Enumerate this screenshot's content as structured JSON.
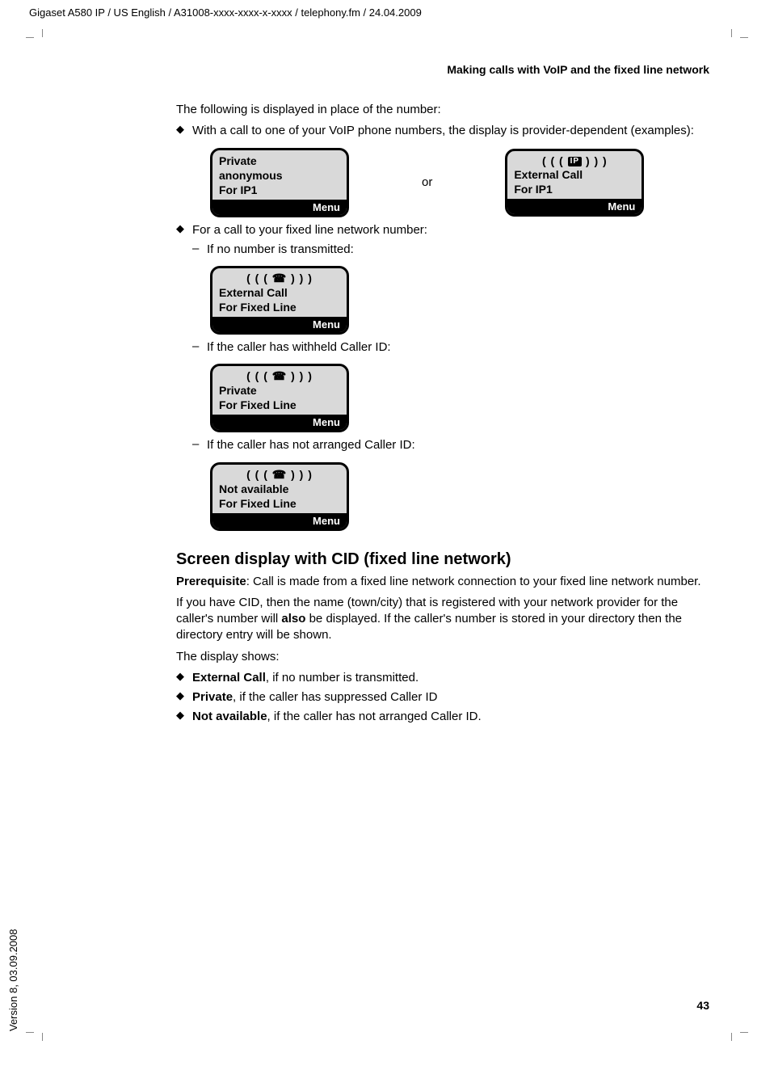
{
  "header": "Gigaset A580 IP / US English / A31008-xxxx-xxxx-x-xxxx / telephony.fm / 24.04.2009",
  "running_head": "Making calls with VoIP and the fixed line network",
  "intro": "The following is displayed in place of the number:",
  "bullets": {
    "b1": "With a call to one of your VoIP phone numbers, the display is provider-dependent (examples):",
    "b2": "For a call to your fixed line network number:"
  },
  "or_word": "or",
  "dashes": {
    "d1": "If no number is transmitted:",
    "d2": "If the caller has withheld Caller ID:",
    "d3": "If the caller has not arranged Caller ID:"
  },
  "screens": {
    "s1": {
      "line1": "Private",
      "line2": "anonymous",
      "line3": "For IP1",
      "menu": "Menu"
    },
    "s2": {
      "ring_l": "( ( (",
      "ring_badge": "IP",
      "ring_r": ") ) )",
      "line1": "External Call",
      "line2": "For IP1",
      "menu": "Menu"
    },
    "s3": {
      "ring_l": "( ( (",
      "ring_sym": "☎",
      "ring_r": ") ) )",
      "line1": "External Call",
      "line2": "For Fixed Line",
      "menu": "Menu"
    },
    "s4": {
      "ring_l": "( ( (",
      "ring_sym": "☎",
      "ring_r": ") ) )",
      "line1": "Private",
      "line2": "For Fixed Line",
      "menu": "Menu"
    },
    "s5": {
      "ring_l": "( ( (",
      "ring_sym": "☎",
      "ring_r": ") ) )",
      "line1": "Not available",
      "line2": "For Fixed Line",
      "menu": "Menu"
    }
  },
  "section_title": "Screen display with CID (fixed line network)",
  "prereq_label": "Prerequisite",
  "prereq_text": ": Call is made from a fixed line network connection to your fixed line network number.",
  "cid_p1_a": "If you have CID, then the name (town/city) that is registered with your network provider for the caller's number will ",
  "cid_p1_bold": "also",
  "cid_p1_b": " be displayed. If the caller's number is stored in your directory then the directory entry will be shown.",
  "shows_intro": "The display shows:",
  "shows": {
    "i1_bold": "External Call",
    "i1_rest": ", if no number is transmitted.",
    "i2_bold": "Private",
    "i2_rest": ", if the caller has suppressed Caller ID",
    "i3_bold": "Not available",
    "i3_rest": ", if the caller has not arranged Caller ID."
  },
  "page_num": "43",
  "version_side": "Version 8, 03.09.2008"
}
